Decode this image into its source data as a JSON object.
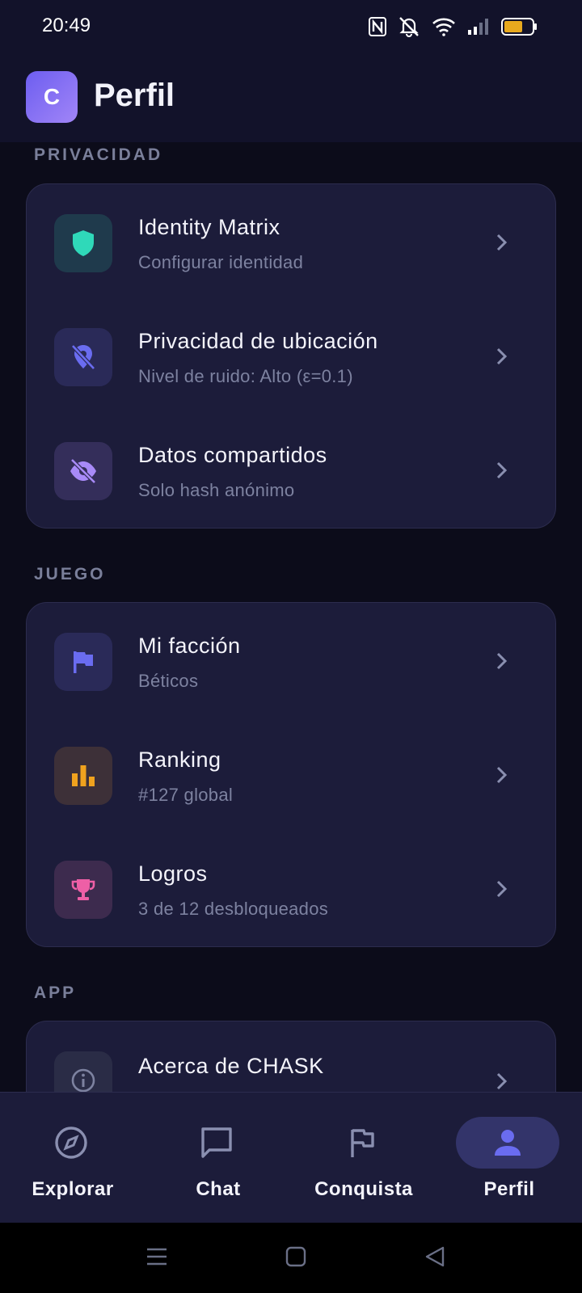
{
  "status_bar": {
    "time": "20:49",
    "battery_color": "#e8a91e"
  },
  "header": {
    "avatar_letter": "C",
    "title": "Perfil"
  },
  "sections": {
    "privacy": {
      "label": "PRIVACIDAD",
      "items": [
        {
          "title": "Identity Matrix",
          "subtitle": "Configurar identidad",
          "icon": "shield-icon",
          "icon_color": "#2fd9b9",
          "icon_bg": "#1f3a4c"
        },
        {
          "title": "Privacidad de ubicación",
          "subtitle": "Nivel de ruido: Alto (ε=0.1)",
          "icon": "location-off-icon",
          "icon_color": "#6a6cf0",
          "icon_bg": "#2a2a58"
        },
        {
          "title": "Datos compartidos",
          "subtitle": "Solo hash anónimo",
          "icon": "eye-off-icon",
          "icon_color": "#a88af8",
          "icon_bg": "#342e5a"
        }
      ]
    },
    "game": {
      "label": "JUEGO",
      "items": [
        {
          "title": "Mi facción",
          "subtitle": "Béticos",
          "icon": "flag-icon",
          "icon_color": "#6a6cf0",
          "icon_bg": "#2a2a58"
        },
        {
          "title": "Ranking",
          "subtitle": "#127 global",
          "icon": "bar-chart-icon",
          "icon_color": "#f0a21e",
          "icon_bg": "#3d3038"
        },
        {
          "title": "Logros",
          "subtitle": "3 de 12 desbloqueados",
          "icon": "trophy-icon",
          "icon_color": "#ee5fa6",
          "icon_bg": "#3d2b4e"
        }
      ]
    },
    "app": {
      "label": "APP",
      "items": [
        {
          "title": "Acerca de CHASK",
          "subtitle": "",
          "icon": "info-icon",
          "icon_color": "#7d82a0",
          "icon_bg": "#2a2c46"
        }
      ]
    }
  },
  "bottom_nav": {
    "active": "Perfil",
    "accent": "#6a6cf0",
    "items": [
      {
        "label": "Explorar",
        "icon": "compass-icon"
      },
      {
        "label": "Chat",
        "icon": "chat-icon"
      },
      {
        "label": "Conquista",
        "icon": "flag-outline-icon"
      },
      {
        "label": "Perfil",
        "icon": "person-icon"
      }
    ]
  }
}
